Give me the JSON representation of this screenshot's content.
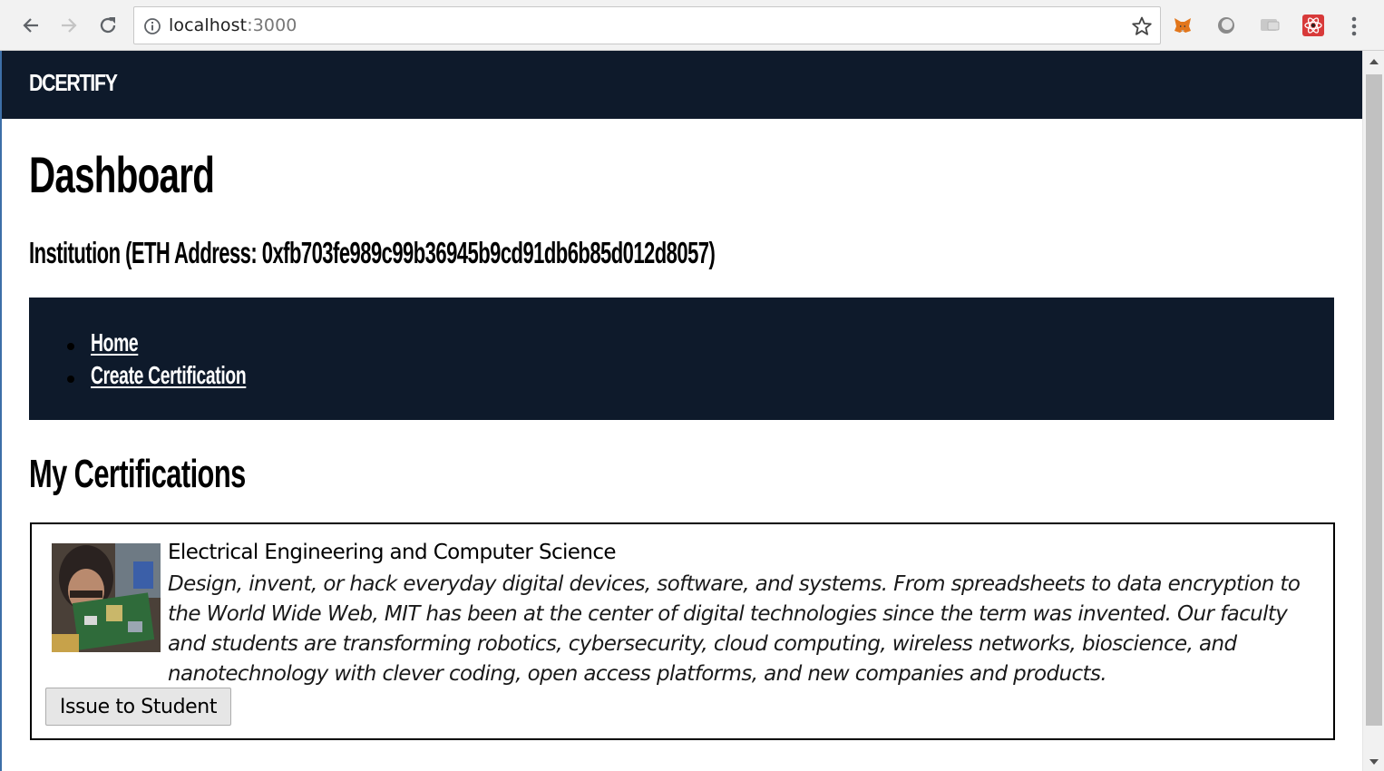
{
  "browser": {
    "url_host": "localhost",
    "url_port": ":3000",
    "icons": {
      "back": "arrow-left-icon",
      "forward": "arrow-right-icon",
      "reload": "reload-icon",
      "info": "info-icon",
      "bookmark": "star-icon",
      "menu": "kebab-menu-icon"
    },
    "extensions": [
      "metamask-fox-icon",
      "circle-extension-icon",
      "cast-extension-icon",
      "react-devtools-icon"
    ]
  },
  "app": {
    "brand": "DCERTIFY",
    "page_title": "Dashboard",
    "institution_label": "Institution (ETH Address: 0xfb703fe989c99b36945b9cd91db6b85d012d8057)",
    "nav": {
      "items": [
        {
          "label": "Home"
        },
        {
          "label": "Create Certification"
        }
      ]
    },
    "certifications_heading": "My Certifications",
    "certifications": [
      {
        "name": "Electrical Engineering and Computer Science",
        "description": "Design, invent, or hack everyday digital devices, software, and systems. From spreadsheets to data encryption to the World Wide Web, MIT has been at the center of digital technologies since the term was invented. Our faculty and students are transforming robotics, cybersecurity, cloud computing, wireless networks, bioscience, and nanotechnology with clever coding, open access platforms, and new companies and products.",
        "button_label": "Issue to Student"
      }
    ]
  },
  "colors": {
    "navy": "#0e1a2b",
    "chrome_bg": "#f2f2f2",
    "link_white": "#ffffff"
  }
}
